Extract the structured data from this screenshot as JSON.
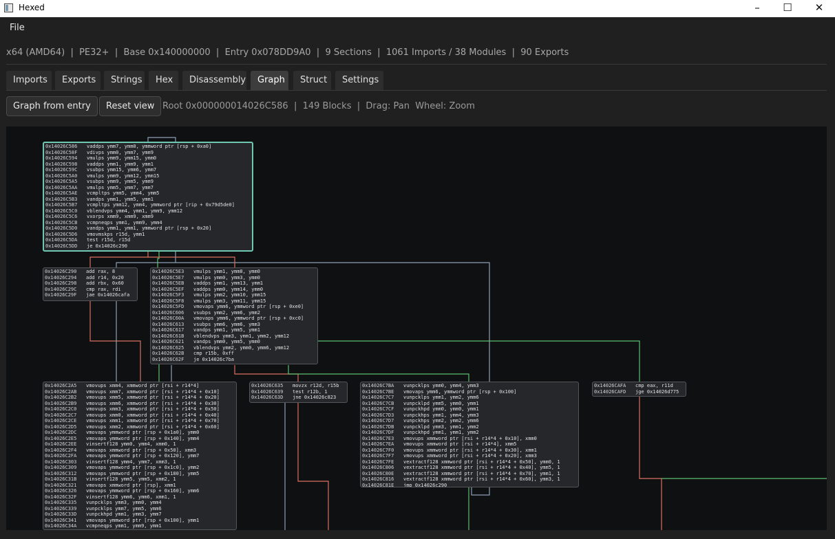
{
  "window": {
    "title": "Hexed"
  },
  "menu": {
    "file": "File"
  },
  "info": {
    "text": "x64 (AMD64)  |  PE32+  |  Base 0x140000000  |  Entry 0x078DD9A0  |  9 Sections  |  1061 Imports / 38 Modules  |  90 Exports"
  },
  "tabs": [
    {
      "label": "Imports"
    },
    {
      "label": "Exports"
    },
    {
      "label": "Strings"
    },
    {
      "label": "Hex"
    },
    {
      "label": "Disassembly"
    },
    {
      "label": "Graph"
    },
    {
      "label": "Struct"
    },
    {
      "label": "Settings"
    }
  ],
  "active_tab": "Graph",
  "toolbar": {
    "graph_from_entry": "Graph from entry",
    "reset_view": "Reset view",
    "status": "Root 0x000000014026C586  |  149 Blocks  |  Drag: Pan  Wheel: Zoom"
  },
  "colors": {
    "edge_true": "#5fbf6f",
    "edge_false": "#d9715f",
    "edge_uncond": "#8d9fb5",
    "root_border": "#6fc9b2"
  },
  "blocks": [
    {
      "id": "b1",
      "root": true,
      "lines": [
        [
          "0x14026C586",
          "vaddps ymm7, ymm0, ymmword ptr [rsp + 0xa0]"
        ],
        [
          "0x14026C58F",
          "vdivps ymm0, ymm7, ymm9"
        ],
        [
          "0x14026C594",
          "vmulps ymm9, ymm15, ymm0"
        ],
        [
          "0x14026C598",
          "vaddps ymm1, ymm9, ymm1"
        ],
        [
          "0x14026C59C",
          "vsubps ymm15, ymm6, ymm7"
        ],
        [
          "0x14026C5A0",
          "vmulps ymm9, ymm12, ymm15"
        ],
        [
          "0x14026C5A5",
          "vsubps ymm9, ymm5, ymm9"
        ],
        [
          "0x14026C5AA",
          "vmulps ymm5, ymm7, ymm7"
        ],
        [
          "0x14026C5AE",
          "vcmpltps ymm5, ymm4, ymm5"
        ],
        [
          "0x14026C5B3",
          "vandps ymm1, ymm5, ymm1"
        ],
        [
          "0x14026C5B7",
          "vcmpltps ymm12, ymm4, ymmword ptr [rip + 0x79d5de0]"
        ],
        [
          "0x14026C5C0",
          "vblendvps ymm4, ymm1, ymm9, ymm12"
        ],
        [
          "0x14026C5C6",
          "vxorps xmm9, xmm9, xmm9"
        ],
        [
          "0x14026C5CB",
          "vcmpneqps ymm1, ymm9, ymm4"
        ],
        [
          "0x14026C5D0",
          "vandps ymm1, ymm1, ymmword ptr [rsp + 0x20]"
        ],
        [
          "0x14026C5D6",
          "vmovmskps r15d, ymm1"
        ],
        [
          "0x14026C5DA",
          "test r15d, r15d"
        ],
        [
          "0x14026C5DD",
          "je 0x14026c290"
        ]
      ]
    },
    {
      "id": "b2",
      "lines": [
        [
          "0x14026C290",
          "add rax, 8"
        ],
        [
          "0x14026C294",
          "add r14, 0x20"
        ],
        [
          "0x14026C298",
          "add rbx, 0x60"
        ],
        [
          "0x14026C29C",
          "cmp rax, rdi"
        ],
        [
          "0x14026C29F",
          "jae 0x14026cafa"
        ]
      ]
    },
    {
      "id": "b3",
      "lines": [
        [
          "0x14026C5E3",
          "vmulps ymm1, ymm8, ymm0"
        ],
        [
          "0x14026C5E7",
          "vmulps ymm0, ymm3, ymm0"
        ],
        [
          "0x14026C5EB",
          "vaddps ymm1, ymm13, ymm1"
        ],
        [
          "0x14026C5EF",
          "vaddps ymm0, ymm14, ymm0"
        ],
        [
          "0x14026C5F3",
          "vmulps ymm2, ymm10, ymm15"
        ],
        [
          "0x14026C5F8",
          "vmulps ymm3, ymm11, ymm15"
        ],
        [
          "0x14026C5FD",
          "vmovaps ymm6, ymmword ptr [rsp + 0xe0]"
        ],
        [
          "0x14026C606",
          "vsubps ymm2, ymm6, ymm2"
        ],
        [
          "0x14026C60A",
          "vmovaps ymm6, ymmword ptr [rsp + 0xc0]"
        ],
        [
          "0x14026C613",
          "vsubps ymm6, ymm6, ymm3"
        ],
        [
          "0x14026C617",
          "vandps ymm1, ymm5, ymm1"
        ],
        [
          "0x14026C61B",
          "vblendvps ymm3, ymm1, ymm2, ymm12"
        ],
        [
          "0x14026C621",
          "vandps ymm0, ymm5, ymm0"
        ],
        [
          "0x14026C625",
          "vblendvps ymm2, ymm0, ymm6, ymm12"
        ],
        [
          "0x14026C62B",
          "cmp r15b, 0xff"
        ],
        [
          "0x14026C62F",
          "je 0x14026c7ba"
        ]
      ]
    },
    {
      "id": "b4",
      "lines": [
        [
          "0x14026C2A5",
          "vmovups xmm4, xmmword ptr [rsi + r14*4]"
        ],
        [
          "0x14026C2AB",
          "vmovups xmm7, xmmword ptr [rsi + r14*4 + 0x10]"
        ],
        [
          "0x14026C2B2",
          "vmovups xmm5, xmmword ptr [rsi + r14*4 + 0x20]"
        ],
        [
          "0x14026C2B9",
          "vmovups xmm6, xmmword ptr [rsi + r14*4 + 0x30]"
        ],
        [
          "0x14026C2C0",
          "vmovups xmm3, xmmword ptr [rsi + r14*4 + 0x50]"
        ],
        [
          "0x14026C2C7",
          "vmovups xmm0, xmmword ptr [rsi + r14*4 + 0x40]"
        ],
        [
          "0x14026C2CE",
          "vmovups xmm1, xmmword ptr [rsi + r14*4 + 0x70]"
        ],
        [
          "0x14026C2D5",
          "vmovups xmm2, xmmword ptr [rsi + r14*4 + 0x60]"
        ],
        [
          "0x14026C2DC",
          "vmovaps ymmword ptr [rsp + 0x1a0], ymm0"
        ],
        [
          "0x14026C2E5",
          "vmovaps ymmword ptr [rsp + 0x140], ymm4"
        ],
        [
          "0x14026C2EE",
          "vinsertf128 ymm0, ymm4, xmm0, 1"
        ],
        [
          "0x14026C2F4",
          "vmovaps xmmword ptr [rsp + 0x50], xmm3"
        ],
        [
          "0x14026C2FA",
          "vmovaps ymmword ptr [rsp + 0x120], ymm7"
        ],
        [
          "0x14026C303",
          "vinsertf128 ymm4, ymm7, xmm3, 1"
        ],
        [
          "0x14026C309",
          "vmovaps ymmword ptr [rsp + 0x1c0], ymm2"
        ],
        [
          "0x14026C312",
          "vmovaps ymmword ptr [rsp + 0x180], ymm5"
        ],
        [
          "0x14026C31B",
          "vinsertf128 ymm5, ymm5, xmm2, 1"
        ],
        [
          "0x14026C321",
          "vmovaps xmmword ptr [rsp], xmm1"
        ],
        [
          "0x14026C326",
          "vmovaps ymmword ptr [rsp + 0x160], ymm6"
        ],
        [
          "0x14026C32F",
          "vinsertf128 ymm6, ymm6, xmm1, 1"
        ],
        [
          "0x14026C335",
          "vunpcklps ymm3, ymm0, ymm4"
        ],
        [
          "0x14026C339",
          "vunpcklps ymm7, ymm5, ymm6"
        ],
        [
          "0x14026C33D",
          "vunpckhpd ymm1, ymm3, ymm7"
        ],
        [
          "0x14026C341",
          "vmovaps ymmword ptr [rsp + 0x100], ymm1"
        ],
        [
          "0x14026C34A",
          "vcmpneqps ymm1, ymm9, ymm1"
        ]
      ]
    },
    {
      "id": "b5",
      "lines": [
        [
          "0x14026C635",
          "movzx r12d, r15b"
        ],
        [
          "0x14026C639",
          "test r12b, 1"
        ],
        [
          "0x14026C63D",
          "jne 0x14026c823"
        ]
      ]
    },
    {
      "id": "b6",
      "lines": [
        [
          "0x14026C7BA",
          "vunpcklps ymm0, ymm4, ymm3"
        ],
        [
          "0x14026C7BE",
          "vmovaps ymm6, ymmword ptr [rsp + 0x100]"
        ],
        [
          "0x14026C7C7",
          "vunpcklps ymm1, ymm2, ymm6"
        ],
        [
          "0x14026C7CB",
          "vunpcklpd ymm5, ymm0, ymm1"
        ],
        [
          "0x14026C7CF",
          "vunpckhpd ymm0, ymm0, ymm1"
        ],
        [
          "0x14026C7D3",
          "vunpckhps ymm1, ymm4, ymm3"
        ],
        [
          "0x14026C7D7",
          "vunpckhps ymm2, ymm2, ymm6"
        ],
        [
          "0x14026C7DB",
          "vunpcklpd ymm3, ymm1, ymm2"
        ],
        [
          "0x14026C7DF",
          "vunpckhpd ymm1, ymm1, ymm2"
        ],
        [
          "0x14026C7E3",
          "vmovups xmmword ptr [rsi + r14*4 + 0x10], xmm0"
        ],
        [
          "0x14026C7EA",
          "vmovups xmmword ptr [rsi + r14*4], xmm5"
        ],
        [
          "0x14026C7F0",
          "vmovups xmmword ptr [rsi + r14*4 + 0x30], xmm1"
        ],
        [
          "0x14026C7F7",
          "vmovups xmmword ptr [rsi + r14*4 + 0x20], xmm3"
        ],
        [
          "0x14026C7FE",
          "vextractf128 xmmword ptr [rsi + r14*4 + 0x50], ymm0, 1"
        ],
        [
          "0x14026C806",
          "vextractf128 xmmword ptr [rsi + r14*4 + 0x40], ymm5, 1"
        ],
        [
          "0x14026C80E",
          "vextractf128 xmmword ptr [rsi + r14*4 + 0x70], ymm1, 1"
        ],
        [
          "0x14026C816",
          "vextractf128 xmmword ptr [rsi + r14*4 + 0x60], ymm3, 1"
        ],
        [
          "0x14026C81E",
          "jmp 0x14026c290"
        ]
      ]
    },
    {
      "id": "b7",
      "lines": [
        [
          "0x14026CAFA",
          "cmp eax, r11d"
        ],
        [
          "0x14026CAFD",
          "jge 0x14026d775"
        ]
      ]
    }
  ]
}
